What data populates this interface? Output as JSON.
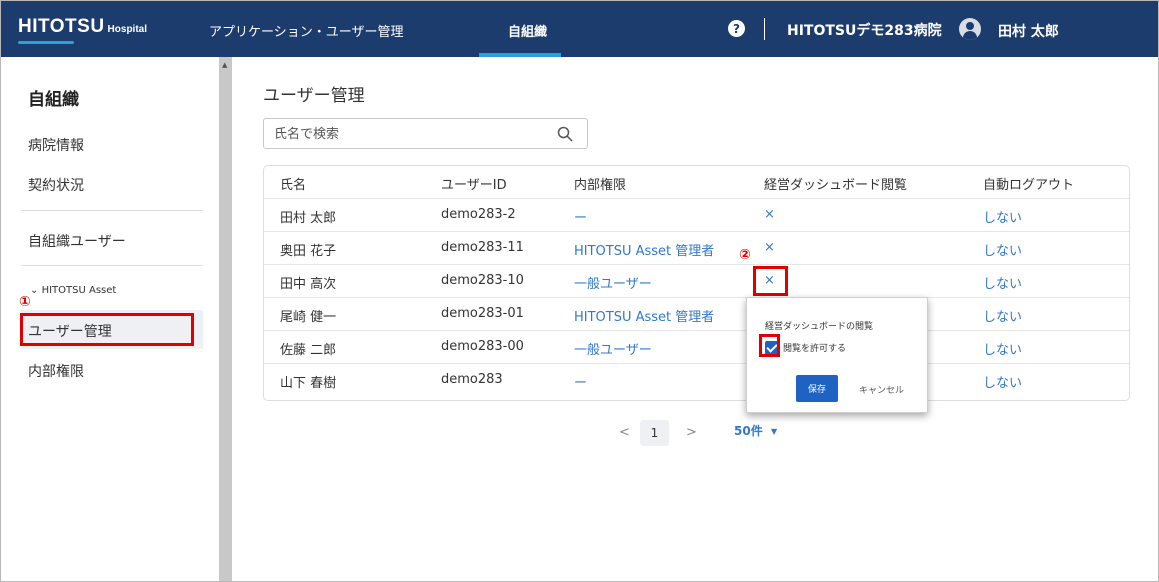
{
  "header": {
    "logo_main": "HITOTSU",
    "logo_sub": "Hospital",
    "nav_app": "アプリケーション・ユーザー管理",
    "nav_org": "自組織",
    "help_glyph": "?",
    "hospital_name": "HITOTSUデモ283病院",
    "user_name": "田村 太郎"
  },
  "sidebar": {
    "title": "自組織",
    "items": [
      "病院情報",
      "契約状況",
      "自組織ユーザー"
    ],
    "group_label": "HITOTSU Asset",
    "sub_items": [
      "ユーザー管理",
      "内部権限"
    ],
    "active": "ユーザー管理"
  },
  "annotations": {
    "num1": "①",
    "num2": "②"
  },
  "main": {
    "title": "ユーザー管理",
    "search_placeholder": "氏名で検索",
    "columns": [
      "氏名",
      "ユーザーID",
      "内部権限",
      "経営ダッシュボード閲覧",
      "自動ログアウト"
    ],
    "rows": [
      {
        "name": "田村 太郎",
        "id": "demo283-2",
        "role": "ー",
        "dashboard": "×",
        "logout": "しない"
      },
      {
        "name": "奥田 花子",
        "id": "demo283-11",
        "role": "HITOTSU Asset 管理者",
        "dashboard": "×",
        "logout": "しない"
      },
      {
        "name": "田中 高次",
        "id": "demo283-10",
        "role": "一般ユーザー",
        "dashboard": "×",
        "logout": "しない"
      },
      {
        "name": "尾崎 健一",
        "id": "demo283-01",
        "role": "HITOTSU Asset 管理者",
        "dashboard": "",
        "logout": "しない"
      },
      {
        "name": "佐藤 二郎",
        "id": "demo283-00",
        "role": "一般ユーザー",
        "dashboard": "",
        "logout": "しない"
      },
      {
        "name": "山下 春樹",
        "id": "demo283",
        "role": "ー",
        "dashboard": "",
        "logout": "しない"
      }
    ]
  },
  "pagination": {
    "prev": "<",
    "page": "1",
    "next": ">",
    "page_size": "50件"
  },
  "popover": {
    "title": "経営ダッシュボードの閲覧",
    "checkbox_label": "閲覧を許可する",
    "checked": true,
    "save": "保存",
    "cancel": "キャンセル"
  },
  "colors": {
    "header_bg": "#1d3c6e",
    "accent": "#2a9fd8",
    "link": "#3278c8",
    "primary_button": "#1e63c4",
    "annotation": "#e00000"
  }
}
